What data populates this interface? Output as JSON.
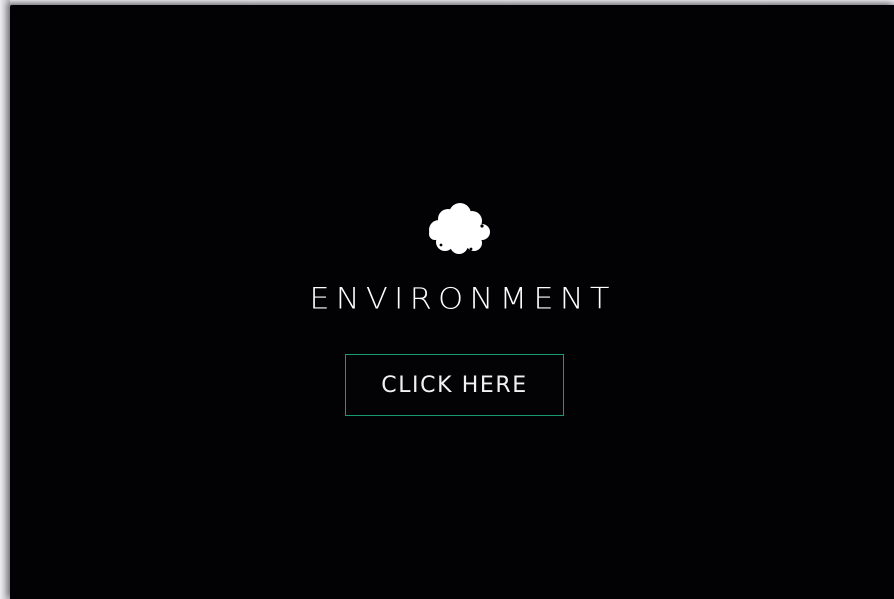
{
  "hero": {
    "logo_icon": "cloud-icon",
    "title": "ENVIRONMENT",
    "cta_label": "CLICK HERE"
  },
  "colors": {
    "background": "#020204",
    "text": "#ffffff",
    "button_border": "#1a9a70"
  }
}
